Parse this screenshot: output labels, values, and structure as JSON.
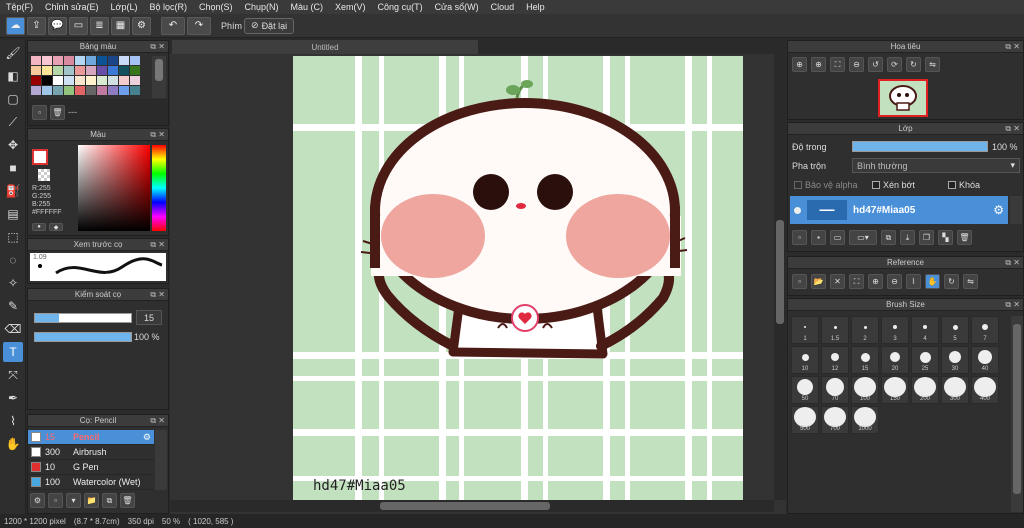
{
  "menu": [
    "Tệp(F)",
    "Chỉnh sửa(E)",
    "Lớp(L)",
    "Bộ lọc(R)",
    "Chọn(S)",
    "Chụp(N)",
    "Màu (C)",
    "Xem(V)",
    "Công cụ(T)",
    "Cửa sổ(W)",
    "Cloud",
    "Help"
  ],
  "toolbar": {
    "phim_label": "Phím",
    "reset_label": "Đặt lại"
  },
  "canvas": {
    "tab_title": "Untitled",
    "watermark": "hd47#Miaa05"
  },
  "palette_panel": {
    "title": "Bảng màu",
    "name_placeholder": "---",
    "swatches": [
      "#f4b6c2",
      "#f7c6d0",
      "#e8a0b4",
      "#d98aa0",
      "#b6d7f2",
      "#6fa8dc",
      "#0b5394",
      "#1c4587",
      "#c9daf8",
      "#a4c2f4",
      "#f9cb9c",
      "#ffe599",
      "#b6d7a8",
      "#a2c4c9",
      "#ea9999",
      "#d5a6bd",
      "#674ea7",
      "#3c78d8",
      "#134f5c",
      "#38761d",
      "#990000",
      "#000000",
      "#ffffff",
      "#cfe2f3",
      "#fce5cd",
      "#fff2cc",
      "#d9ead3",
      "#d0e0e3",
      "#f4cccc",
      "#ead1dc",
      "#b4a7d6",
      "#9fc5e8",
      "#76a5af",
      "#93c47d",
      "#e06666",
      "#666666",
      "#c27ba0",
      "#8e7cc3",
      "#6d9eeb",
      "#45818e"
    ]
  },
  "color_panel": {
    "title": "Màu",
    "r": "R:255",
    "g": "G:255",
    "b": "B:255",
    "hex": "#FFFFFF"
  },
  "preview_panel": {
    "title": "Xem trước cọ",
    "size": "1.09"
  },
  "brush_control": {
    "title": "Kiểm soát cọ",
    "size_value": "15",
    "opacity_value": "100 %",
    "size_fraction": 0.25,
    "opacity_fraction": 1.0
  },
  "brush_list": {
    "title": "Cọ: Pencil",
    "items": [
      {
        "size": "15",
        "name": "Pencil",
        "color": "#ffffff",
        "selected": true
      },
      {
        "size": "300",
        "name": "Airbrush",
        "color": "#ffffff",
        "selected": false
      },
      {
        "size": "10",
        "name": "G Pen",
        "color": "#e03030",
        "selected": false
      },
      {
        "size": "100",
        "name": "Watercolor (Wet)",
        "color": "#4aa8e0",
        "selected": false
      }
    ]
  },
  "navigator": {
    "title": "Hoa tiêu"
  },
  "layers": {
    "title": "Lớp",
    "opacity_label": "Độ trong",
    "opacity_value": "100 %",
    "opacity_fraction": 1.0,
    "blend_label": "Pha trộn",
    "blend_value": "Bình thường",
    "protect_alpha": "Bảo vệ alpha",
    "clip": "Xén bớt",
    "lock": "Khóa",
    "layer_name": "hd47#Miaa05"
  },
  "reference": {
    "title": "Reference"
  },
  "brush_size": {
    "title": "Brush Size",
    "rows": [
      [
        "1",
        "1.5",
        "2",
        "3",
        "4",
        "5",
        "7"
      ],
      [
        "10",
        "12",
        "15",
        "20",
        "25",
        "30",
        "40"
      ],
      [
        "50",
        "70",
        "100",
        "150",
        "200",
        "300",
        "400"
      ],
      [
        "500",
        "700",
        "1000"
      ]
    ]
  },
  "status": {
    "dimensions": "1200 * 1200 pixel",
    "cm": "(8.7 * 8.7cm)",
    "dpi": "350 dpi",
    "zoom": "50 %",
    "coords": "( 1020, 585 )"
  }
}
